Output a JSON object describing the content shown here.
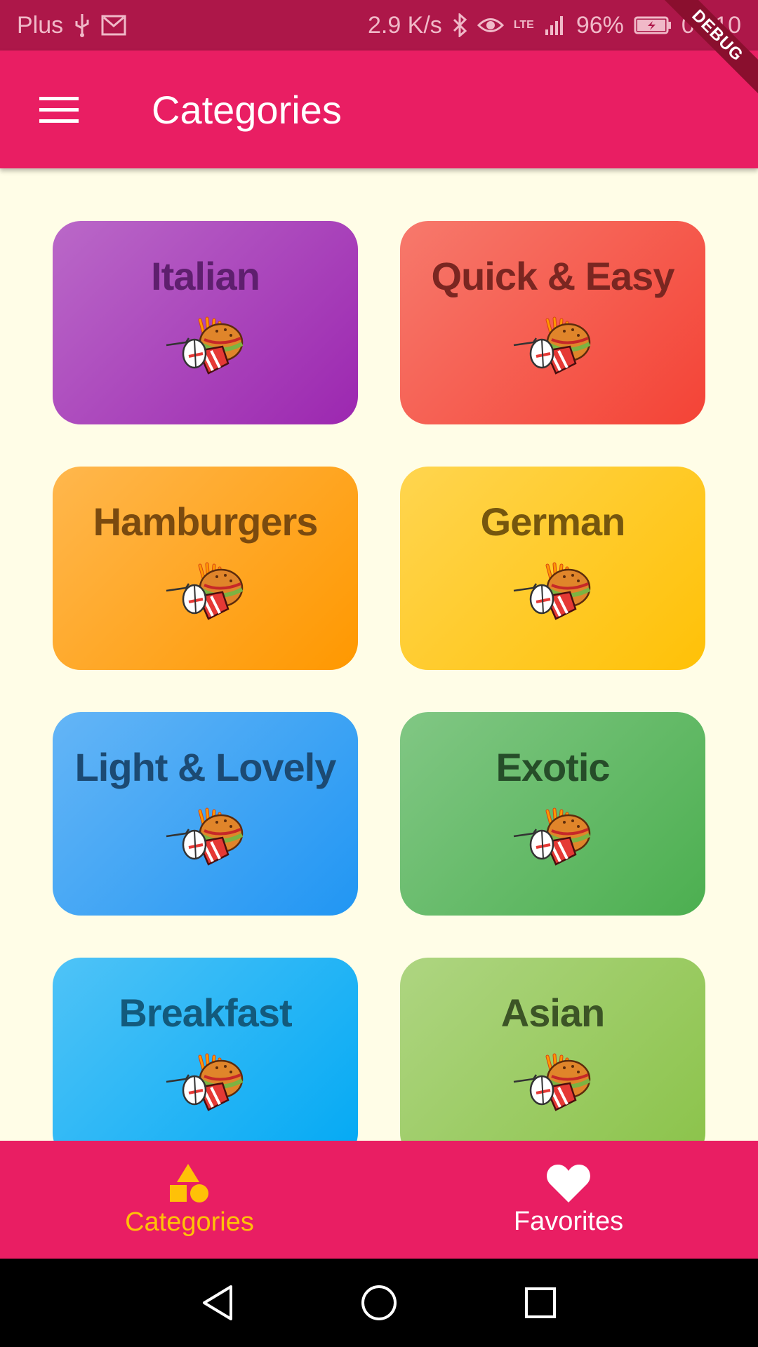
{
  "status_bar": {
    "carrier": "Plus",
    "speed": "2.9 K/s",
    "network": "LTE",
    "battery": "96%",
    "time": "09:10",
    "icons": [
      "usb-icon",
      "gmail-icon",
      "bluetooth-icon",
      "eye-icon",
      "signal-icon",
      "battery-charging-icon"
    ]
  },
  "debug_banner": "DEBUG",
  "app_bar": {
    "title": "Categories",
    "menu_icon": "menu-icon"
  },
  "categories": [
    {
      "title": "Italian",
      "color_start": "#ba68c8",
      "color_end": "#9c27b0",
      "text_color": "#5e1f6e"
    },
    {
      "title": "Quick & Easy",
      "color_start": "#f7796c",
      "color_end": "#f44336",
      "text_color": "#7a2621"
    },
    {
      "title": "Hamburgers",
      "color_start": "#ffb74d",
      "color_end": "#ff9800",
      "text_color": "#7a4a0f"
    },
    {
      "title": "German",
      "color_start": "#ffd54f",
      "color_end": "#ffc107",
      "text_color": "#75560e"
    },
    {
      "title": "Light & Lovely",
      "color_start": "#64b5f6",
      "color_end": "#2196f3",
      "text_color": "#1c4a73"
    },
    {
      "title": "Exotic",
      "color_start": "#81c784",
      "color_end": "#4caf50",
      "text_color": "#264d29"
    },
    {
      "title": "Breakfast",
      "color_start": "#4fc3f7",
      "color_end": "#03a9f4",
      "text_color": "#135a7c"
    },
    {
      "title": "Asian",
      "color_start": "#aed581",
      "color_end": "#8bc34a",
      "text_color": "#3c5426"
    }
  ],
  "bottom_nav": {
    "items": [
      {
        "label": "Categories",
        "icon": "category-shapes-icon",
        "active": true
      },
      {
        "label": "Favorites",
        "icon": "heart-icon",
        "active": false
      }
    ],
    "active_color": "#ffc107",
    "inactive_color": "#ffffff"
  },
  "system_nav": {
    "icons": [
      "back-icon",
      "home-icon",
      "recents-icon"
    ]
  }
}
